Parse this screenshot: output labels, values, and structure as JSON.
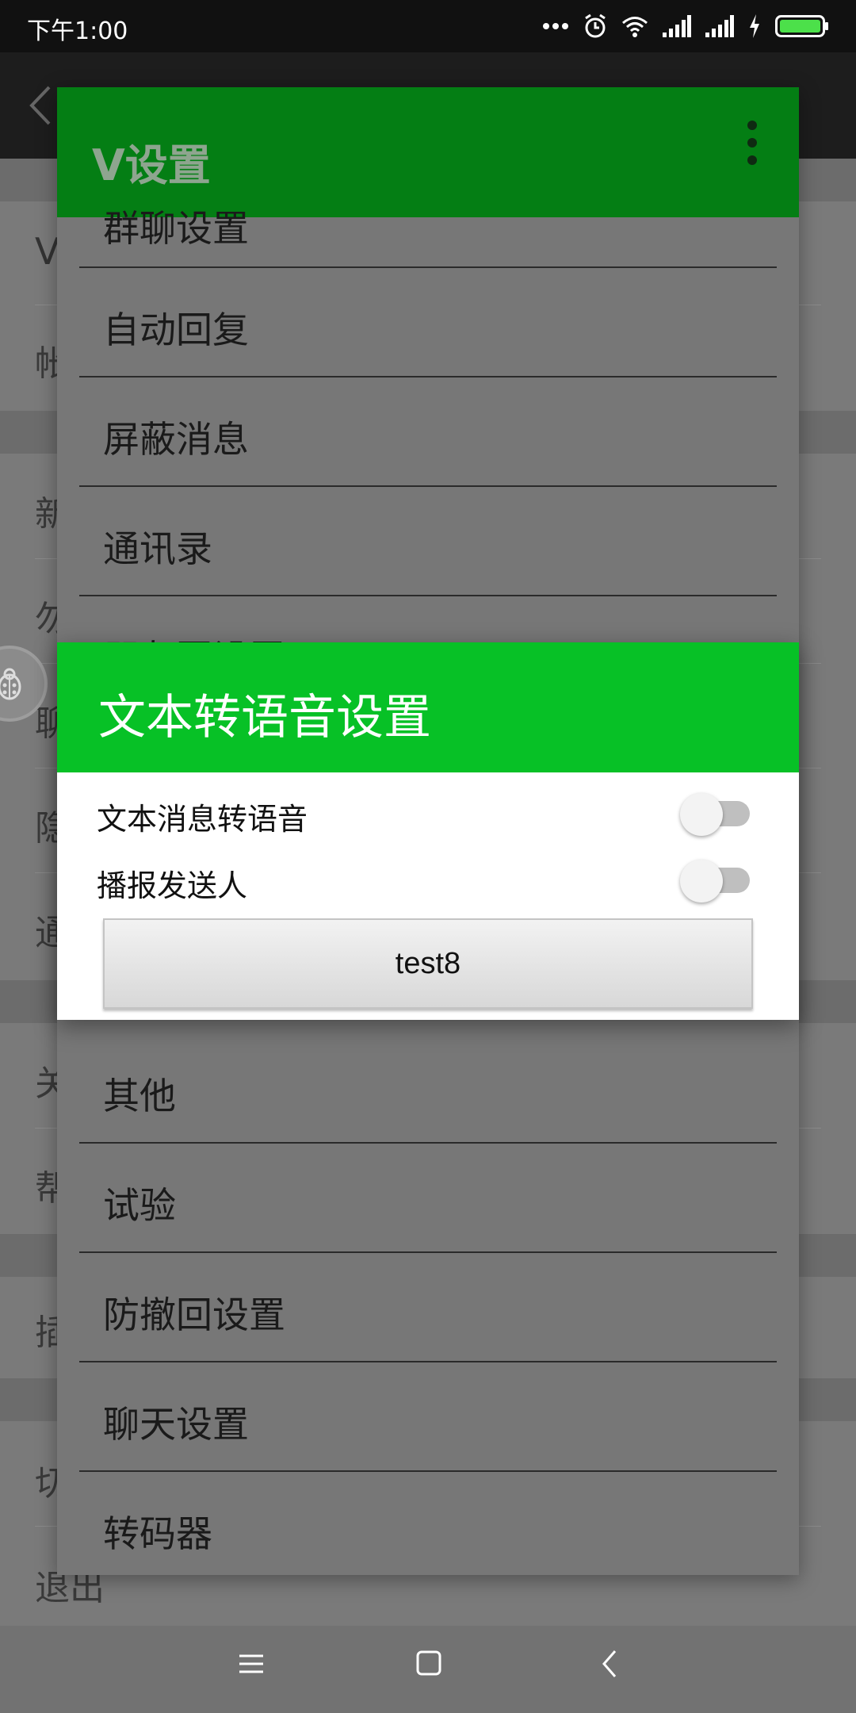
{
  "status_bar": {
    "time": "下午1:00",
    "icons": [
      "dots-icon",
      "alarm-icon",
      "wifi-icon",
      "signal-icon",
      "signal-icon",
      "charging-icon",
      "battery-icon"
    ]
  },
  "background": {
    "rows": [
      {
        "label": "V"
      },
      {
        "label": "帐"
      },
      {
        "label": "新"
      },
      {
        "label": "勿"
      },
      {
        "label": "聊"
      },
      {
        "label": "隐"
      },
      {
        "label": "通"
      },
      {
        "label": "关"
      },
      {
        "label": "帮"
      },
      {
        "label": "插"
      },
      {
        "label": "切"
      },
      {
        "label": "退出"
      }
    ]
  },
  "panel": {
    "title": "V设置",
    "items": [
      {
        "label": "群聊设置"
      },
      {
        "label": "自动回复"
      },
      {
        "label": "屏蔽消息"
      },
      {
        "label": "通讯录"
      },
      {
        "label": "朋友圈设置"
      },
      {
        "label": "其他"
      },
      {
        "label": "试验"
      },
      {
        "label": "防撤回设置"
      },
      {
        "label": "聊天设置"
      },
      {
        "label": "转码器"
      }
    ]
  },
  "dialog": {
    "title": "文本转语音设置",
    "options": [
      {
        "label": "文本消息转语音",
        "enabled": false
      },
      {
        "label": "播报发送人",
        "enabled": false
      }
    ],
    "button_label": "test8"
  },
  "colors": {
    "panel_header": "#047e14",
    "dialog_header": "#07c126",
    "scrim": "#727272"
  },
  "nav_bar": {
    "icons": [
      "menu-icon",
      "home-icon",
      "back-icon"
    ]
  }
}
